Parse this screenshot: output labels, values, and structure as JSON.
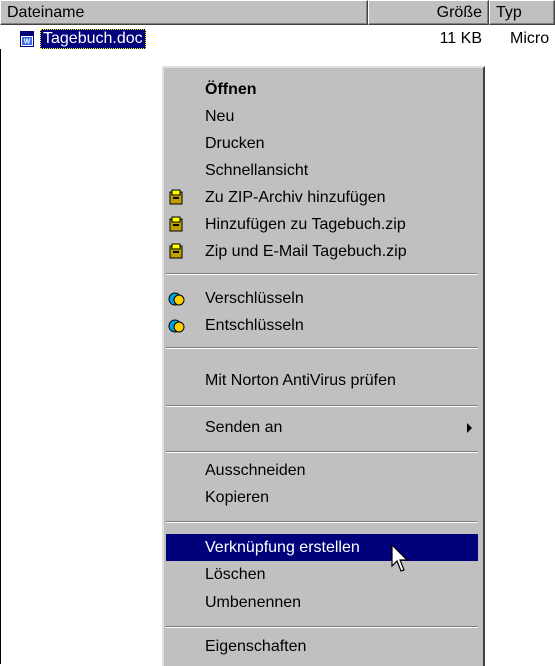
{
  "header": {
    "name_label": "Dateiname",
    "size_label": "Größe",
    "type_label": "Typ"
  },
  "file": {
    "name": "Tagebuch.doc",
    "size": "11 KB",
    "type": "Micro",
    "icon": "word-document-icon"
  },
  "menu": {
    "open": "Öffnen",
    "new": "Neu",
    "print": "Drucken",
    "quickview": "Schnellansicht",
    "zip_add": "Zu ZIP-Archiv hinzufügen",
    "zip_add_to": "Hinzufügen zu Tagebuch.zip",
    "zip_mail": "Zip und E-Mail Tagebuch.zip",
    "encrypt": "Verschlüsseln",
    "decrypt": "Entschlüsseln",
    "norton": "Mit Norton AntiVirus prüfen",
    "send_to": "Senden an",
    "cut": "Ausschneiden",
    "copy": "Kopieren",
    "create_shortcut": "Verknüpfung erstellen",
    "delete": "Löschen",
    "rename": "Umbenennen",
    "properties": "Eigenschaften"
  },
  "colors": {
    "selection": "#00007b",
    "menu_bg": "#c0c0c0"
  }
}
